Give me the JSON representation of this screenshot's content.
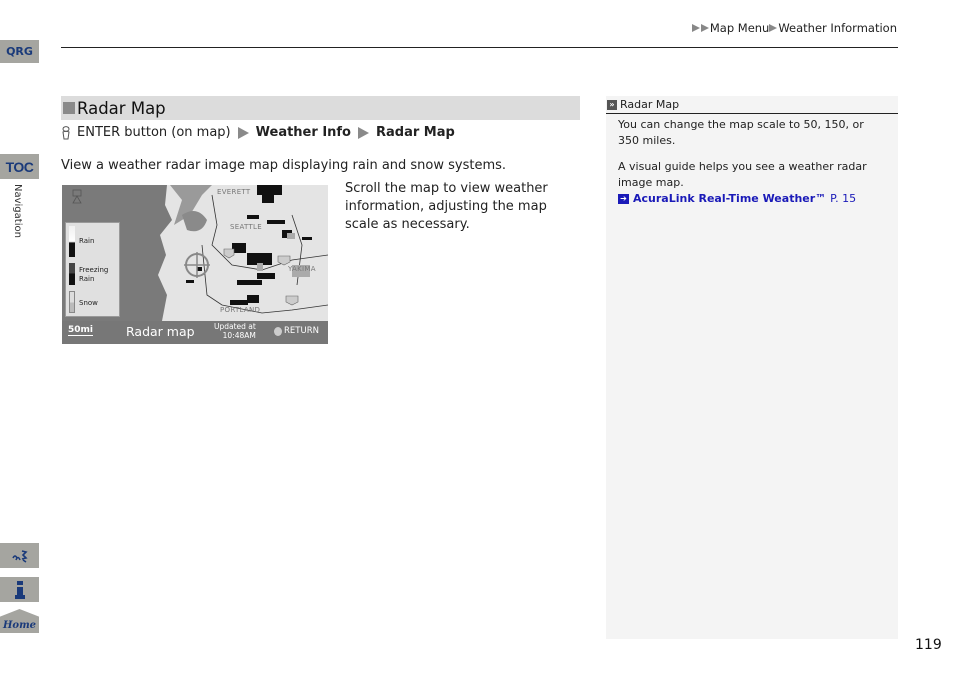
{
  "nav_tabs": {
    "qrg": "QRG",
    "toc": "TOC",
    "section": "Navigation",
    "home": "Home"
  },
  "breadcrumb": {
    "items": [
      "Map Menu",
      "Weather Information"
    ]
  },
  "section": {
    "title": "Radar Map",
    "path": {
      "start": "ENTER button (on map)",
      "step1": "Weather Info",
      "step2": "Radar Map"
    },
    "intro": "View a weather radar image map displaying rain and snow systems.",
    "description": "Scroll the map to view weather information, adjusting the map scale as necessary."
  },
  "map_screen": {
    "title": "Radar map",
    "scale": "50mi",
    "updated_label": "Updated at",
    "updated_time": "10:48AM",
    "return_label": "RETURN",
    "cities": [
      "SEATTLE",
      "PORTLAND",
      "YAKIMA",
      "EVERETT"
    ],
    "legend": [
      "Rain",
      "Freezing Rain",
      "Snow"
    ],
    "highway_shields": [
      "5",
      "90",
      "84"
    ]
  },
  "note": {
    "title": "Radar Map",
    "para1": "You can change the map scale to 50, 150, or 350 miles.",
    "para2": "A visual guide helps you see a weather radar image map.",
    "link_text": "AcuraLink Real-Time Weather™",
    "link_page": "P. 15"
  },
  "page_number": "119"
}
